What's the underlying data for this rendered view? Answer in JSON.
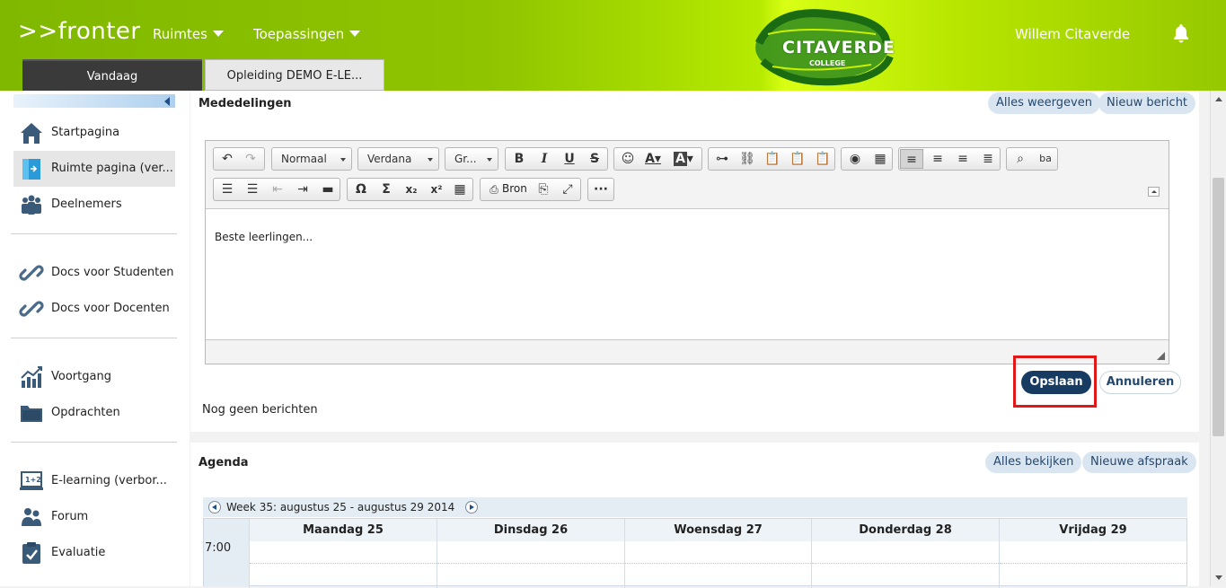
{
  "header": {
    "logo": ">>fronter",
    "menu": [
      {
        "label": "Ruimtes"
      },
      {
        "label": "Toepassingen"
      }
    ],
    "brand_name": "CITAVERDE",
    "brand_sub": "COLLEGE",
    "user": "Willem Citaverde",
    "tabs": [
      {
        "label": "Vandaag"
      },
      {
        "label": "Opleiding DEMO E-LE..."
      }
    ]
  },
  "sidebar": {
    "items": [
      {
        "label": "Startpagina",
        "icon": "home-icon"
      },
      {
        "label": "Ruimte pagina (ver...",
        "icon": "room-page-icon"
      },
      {
        "label": "Deelnemers",
        "icon": "people-icon"
      },
      {
        "label": "Docs voor Studenten",
        "icon": "link-icon"
      },
      {
        "label": "Docs voor Docenten",
        "icon": "link-icon"
      },
      {
        "label": "Voortgang",
        "icon": "progress-chart-icon"
      },
      {
        "label": "Opdrachten",
        "icon": "folder-icon"
      },
      {
        "label": "E-learning (verbor...",
        "icon": "elearning-icon"
      },
      {
        "label": "Forum",
        "icon": "forum-icon"
      },
      {
        "label": "Evaluatie",
        "icon": "evaluation-icon"
      }
    ]
  },
  "announcements": {
    "title": "Mededelingen",
    "show_all": "Alles weergeven",
    "new_message": "Nieuw bericht",
    "editor": {
      "format": "Normaal",
      "font": "Verdana",
      "size": "Gr...",
      "source_label": "Bron",
      "content": "Beste leerlingen..."
    },
    "save": "Opslaan",
    "cancel": "Annuleren",
    "empty": "Nog geen berichten"
  },
  "agenda": {
    "title": "Agenda",
    "view_all": "Alles bekijken",
    "new_appointment": "Nieuwe afspraak",
    "week_label": "Week 35: augustus 25 - augustus 29 2014",
    "days": [
      "Maandag 25",
      "Dinsdag 26",
      "Woensdag 27",
      "Donderdag 28",
      "Vrijdag 29"
    ],
    "time": "7:00"
  },
  "colors": {
    "header_green": "#8fc400",
    "button_navy": "#173b61",
    "pill_blue": "#d9e6f2",
    "highlight_red": "#e01818"
  }
}
